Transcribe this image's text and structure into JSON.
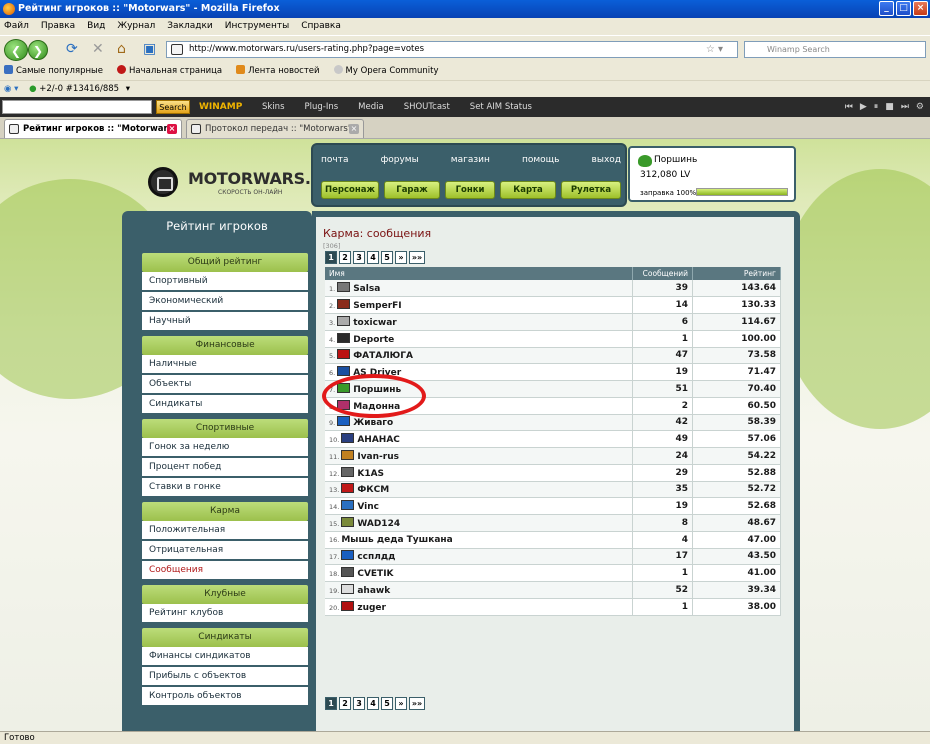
{
  "window": {
    "title": "Рейтинг игроков :: \"Motorwars\" - Mozilla Firefox"
  },
  "menu": [
    "Файл",
    "Правка",
    "Вид",
    "Журнал",
    "Закладки",
    "Инструменты",
    "Справка"
  ],
  "nav": {
    "url": "http://www.motorwars.ru/users-rating.php?page=votes",
    "search_placeholder": "Winamp Search"
  },
  "bookmarks": [
    "Самые популярные",
    "Начальная страница",
    "Лента новостей",
    "My Opera Community"
  ],
  "statusline": {
    "text": "+2/-0  #13416/885"
  },
  "winamp": {
    "search_btn": "Search",
    "logo": "WINAMP",
    "menus": [
      "Skins",
      "Plug-Ins",
      "Media",
      "SHOUTcast",
      "Set AIM Status"
    ]
  },
  "tabs": [
    {
      "label": "Рейтинг игроков :: \"Motorwars\""
    },
    {
      "label": "Протокол передач :: \"Motorwars\""
    }
  ],
  "site": {
    "logo": "MOTORWARS.RU",
    "logo_sub": "СКОРОСТЬ ОН-ЛАЙН",
    "topnav": [
      "почта",
      "форумы",
      "магазин",
      "помощь",
      "выход"
    ],
    "buttons": [
      "Персонаж",
      "Гараж",
      "Гонки",
      "Карта",
      "Рулетка"
    ],
    "user": {
      "name": "Поршинь",
      "balance": "312,080 LV",
      "fuel_label": "заправка 100%",
      "fuel": 1.0
    }
  },
  "sidebar": {
    "title": "Рейтинг игроков",
    "groups": [
      {
        "label": "Общий рейтинг",
        "items": [
          "Спортивный",
          "Экономический",
          "Научный"
        ]
      },
      {
        "label": "Финансовые",
        "items": [
          "Наличные",
          "Объекты",
          "Синдикаты"
        ]
      },
      {
        "label": "Спортивные",
        "items": [
          "Гонок за неделю",
          "Процент побед",
          "Ставки в гонке"
        ]
      },
      {
        "label": "Карма",
        "items": [
          "Положительная",
          "Отрицательная",
          "Сообщения"
        ]
      },
      {
        "label": "Клубные",
        "items": [
          "Рейтинг клубов"
        ]
      },
      {
        "label": "Синдикаты",
        "items": [
          "Финансы синдикатов",
          "Прибыль с объектов",
          "Контроль объектов"
        ]
      }
    ],
    "selected": "Сообщения"
  },
  "main": {
    "title": "Карма: сообщения",
    "count": "[306]",
    "pages": [
      "1",
      "2",
      "3",
      "4",
      "5",
      "»",
      "»»"
    ],
    "columns": [
      "Имя",
      "Сообщений",
      "Рейтинг"
    ],
    "rows": [
      {
        "n": "1.",
        "name": "Salsa",
        "msgs": "39",
        "rating": "143.64",
        "c": "#777"
      },
      {
        "n": "2.",
        "name": "SemperFI",
        "msgs": "14",
        "rating": "130.33",
        "c": "#8a2b1a"
      },
      {
        "n": "3.",
        "name": "toxicwar",
        "msgs": "6",
        "rating": "114.67",
        "c": "#aaa"
      },
      {
        "n": "4.",
        "name": "Deporte",
        "msgs": "1",
        "rating": "100.00",
        "c": "#2a2a2a"
      },
      {
        "n": "5.",
        "name": "ФАТАЛЮГА",
        "msgs": "47",
        "rating": "73.58",
        "c": "#b11"
      },
      {
        "n": "6.",
        "name": "AS Driver",
        "msgs": "19",
        "rating": "71.47",
        "c": "#1a4fa0"
      },
      {
        "n": "7.",
        "name": "Поршинь",
        "msgs": "51",
        "rating": "70.40",
        "c": "#3a9a2a"
      },
      {
        "n": "8.",
        "name": "Мадонна",
        "msgs": "2",
        "rating": "60.50",
        "c": "#b0306a"
      },
      {
        "n": "9.",
        "name": "Живаго",
        "msgs": "42",
        "rating": "58.39",
        "c": "#1a5fc0"
      },
      {
        "n": "10.",
        "name": "АНАНАС",
        "msgs": "49",
        "rating": "57.06",
        "c": "#2a3f80"
      },
      {
        "n": "11.",
        "name": "Ivan-rus",
        "msgs": "24",
        "rating": "54.22",
        "c": "#c08020"
      },
      {
        "n": "12.",
        "name": "K1AS",
        "msgs": "29",
        "rating": "52.88",
        "c": "#666"
      },
      {
        "n": "13.",
        "name": "ФКСМ",
        "msgs": "35",
        "rating": "52.72",
        "c": "#c01818"
      },
      {
        "n": "14.",
        "name": "Vinc",
        "msgs": "19",
        "rating": "52.68",
        "c": "#2a6fc0"
      },
      {
        "n": "15.",
        "name": "WAD124",
        "msgs": "8",
        "rating": "48.67",
        "c": "#7a8a3a"
      },
      {
        "n": "16.",
        "name": "Мышь деда Тушкана",
        "msgs": "4",
        "rating": "47.00",
        "c": ""
      },
      {
        "n": "17.",
        "name": "ссплдд",
        "msgs": "17",
        "rating": "43.50",
        "c": "#1a5fc0"
      },
      {
        "n": "18.",
        "name": "CVETIK",
        "msgs": "1",
        "rating": "41.00",
        "c": "#555"
      },
      {
        "n": "19.",
        "name": "ahawk",
        "msgs": "52",
        "rating": "39.34",
        "c": "#ddd"
      },
      {
        "n": "20.",
        "name": "zuger",
        "msgs": "1",
        "rating": "38.00",
        "c": "#b01010"
      }
    ]
  },
  "status": {
    "text": "Готово"
  }
}
